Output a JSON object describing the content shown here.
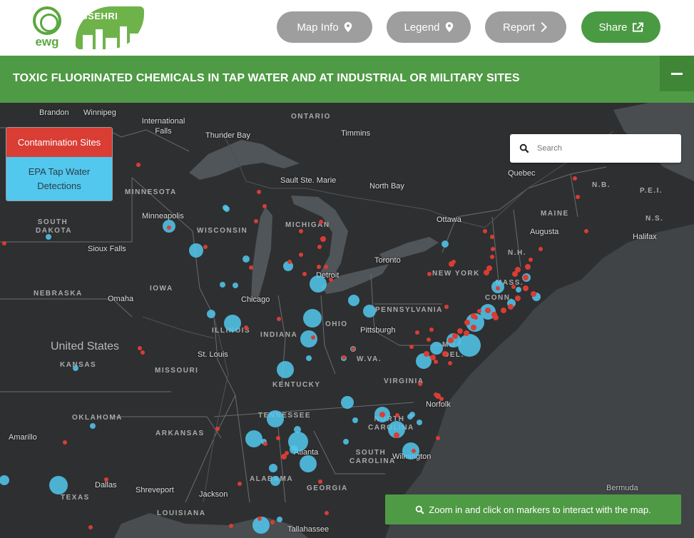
{
  "header": {
    "logo_ewg": "ewg",
    "logo_ssehri": "SSEHRI",
    "buttons": {
      "map_info": "Map Info",
      "legend": "Legend",
      "report": "Report",
      "share": "Share"
    }
  },
  "titlebar": {
    "title": "TOXIC FLUORINATED CHEMICALS IN TAP WATER AND AT INDUSTRIAL OR MILITARY SITES"
  },
  "legend_toggles": {
    "contamination": "Contamination Sites",
    "epa": "EPA Tap Water Detections"
  },
  "search": {
    "placeholder": "Search"
  },
  "hint": "Zoom in and click on markers to interact with the map.",
  "map_labels": {
    "places": [
      "Brandon",
      "Winnipeg",
      "International Falls",
      "Thunder Bay",
      "Timmins",
      "Sault Ste. Marie",
      "North Bay",
      "Quebec",
      "Minneapolis",
      "Sioux Falls",
      "Ottawa",
      "Augusta",
      "Halifax",
      "Toronto",
      "Detroit",
      "Chicago",
      "Omaha",
      "Pittsburgh",
      "St. Louis",
      "Norfolk",
      "Atlanta",
      "Wilmington",
      "Amarillo",
      "Dallas",
      "Shreveport",
      "Jackson",
      "Tallahassee",
      "Bermuda"
    ],
    "regions": [
      "ONTARIO",
      "MINNESOTA",
      "WISCONSIN",
      "MICHIGAN",
      "SOUTH DAKOTA",
      "NEBRASKA",
      "IOWA",
      "ILLINOIS",
      "INDIANA",
      "OHIO",
      "PENNSYLVANIA",
      "NEW YORK",
      "MAINE",
      "N.B.",
      "P.E.I.",
      "N.S.",
      "N.H.",
      "MASS.",
      "CONN.",
      "W.VA.",
      "VIRGINIA",
      "KENTUCKY",
      "KANSAS",
      "MISSOURI",
      "OKLAHOMA",
      "ARKANSAS",
      "TENNESSEE",
      "NORTH CAROLINA",
      "SOUTH CAROLINA",
      "ALABAMA",
      "GEORGIA",
      "TEXAS",
      "LOUISIANA",
      "MD.",
      "DEL."
    ],
    "country": "United States"
  },
  "colors": {
    "brand_green": "#4f9a45",
    "contamination_red": "#d93d34",
    "epa_blue": "#52c8ee",
    "button_gray": "#9e9e9e",
    "map_land": "#2e2f31",
    "map_water": "#505559"
  },
  "icons": {
    "map_info": "map-marker-icon",
    "legend": "map-marker-icon",
    "report": "chevron-right-icon",
    "share": "share-icon",
    "search": "search-icon",
    "hint": "search-icon",
    "collapse": "minus-icon"
  }
}
